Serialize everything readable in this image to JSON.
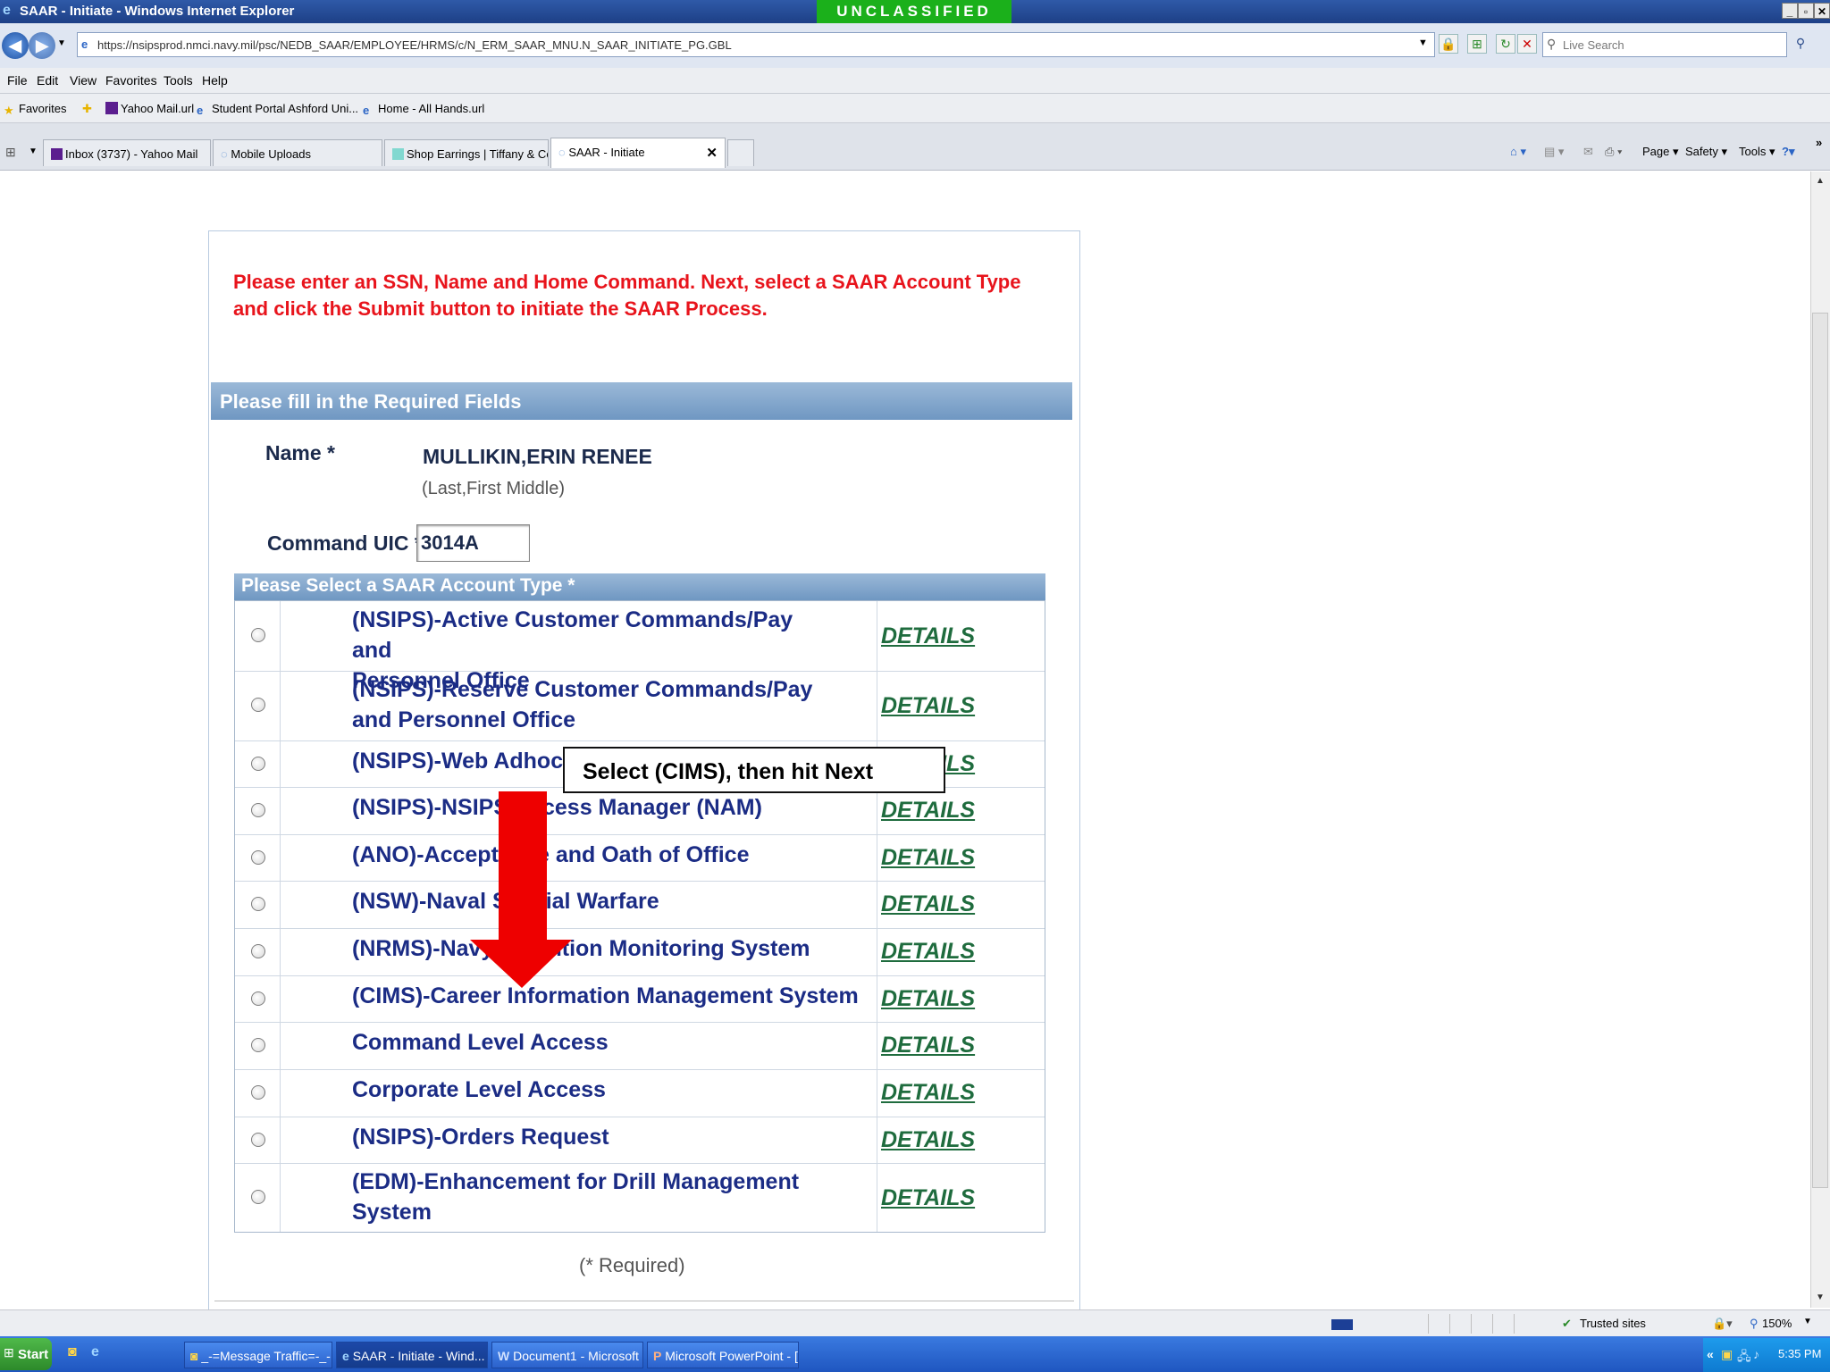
{
  "window": {
    "title": "SAAR - Initiate - Windows Internet Explorer",
    "classification": "UNCLASSIFIED"
  },
  "address": {
    "url": "https://nsipsprod.nmci.navy.mil/psc/NEDB_SAAR/EMPLOYEE/HRMS/c/N_ERM_SAAR_MNU.N_SAAR_INITIATE_PG.GBL",
    "search_placeholder": "Live Search"
  },
  "menu": [
    "File",
    "Edit",
    "View",
    "Favorites",
    "Tools",
    "Help"
  ],
  "favorites": {
    "label": "Favorites",
    "items": [
      "Yahoo Mail.url",
      "Student Portal  Ashford Uni...",
      "Home - All Hands.url"
    ]
  },
  "tabs": [
    {
      "label": "Inbox (3737) - Yahoo Mail"
    },
    {
      "label": "Mobile Uploads"
    },
    {
      "label": "Shop Earrings | Tiffany & Co."
    },
    {
      "label": "SAAR - Initiate"
    }
  ],
  "commands": {
    "page": "Page ▾",
    "safety": "Safety ▾",
    "tools": "Tools ▾"
  },
  "instructions": "Please enter an SSN, Name and Home Command. Next, select a SAAR Account Type and click the Submit button to initiate the SAAR Process.",
  "form": {
    "section_title": "Please fill in the Required Fields",
    "name_label": "Name *",
    "name_value": "MULLIKIN,ERIN RENEE",
    "name_hint": "(Last,First Middle)",
    "uic_label": "Command UIC *",
    "uic_value": "3014A",
    "account_header": "Please Select a SAAR Account Type *",
    "details_label": "DETAILS",
    "account_types": [
      {
        "line1": "(NSIPS)-Active Customer Commands/Pay and",
        "line2": "Personnel Office"
      },
      {
        "line1": "(NSIPS)-Reserve Customer Commands/Pay",
        "line2": "and Personnel Office"
      },
      {
        "line1": "(NSIPS)-Web Adhoc",
        "line2": ""
      },
      {
        "line1": "(NSIPS)-NSIPS Access Manager (NAM)",
        "line2": ""
      },
      {
        "line1": "(ANO)-Acceptance and Oath of Office",
        "line2": ""
      },
      {
        "line1": "(NSW)-Naval Special Warfare",
        "line2": ""
      },
      {
        "line1": "(NRMS)-Navy Retention Monitoring System",
        "line2": ""
      },
      {
        "line1": "(CIMS)-Career Information Management System",
        "line2": ""
      },
      {
        "line1": "Command Level Access",
        "line2": ""
      },
      {
        "line1": "Corporate Level Access",
        "line2": ""
      },
      {
        "line1": "(NSIPS)-Orders Request",
        "line2": ""
      },
      {
        "line1": "(EDM)-Enhancement for Drill Management",
        "line2": "System"
      }
    ],
    "required_note": "(* Required)"
  },
  "annotation": {
    "callout": "Select (CIMS), then hit Next",
    "arrow_color": "#ee0000"
  },
  "status": {
    "zone": "Trusted sites",
    "zoom": "150%"
  },
  "taskbar": {
    "start": "Start",
    "tasks": [
      "_-=Message Traffic=-_-...",
      "SAAR - Initiate - Wind...",
      "Document1 - Microsoft ...",
      "Microsoft PowerPoint - [..."
    ],
    "clock": "5:35 PM"
  }
}
